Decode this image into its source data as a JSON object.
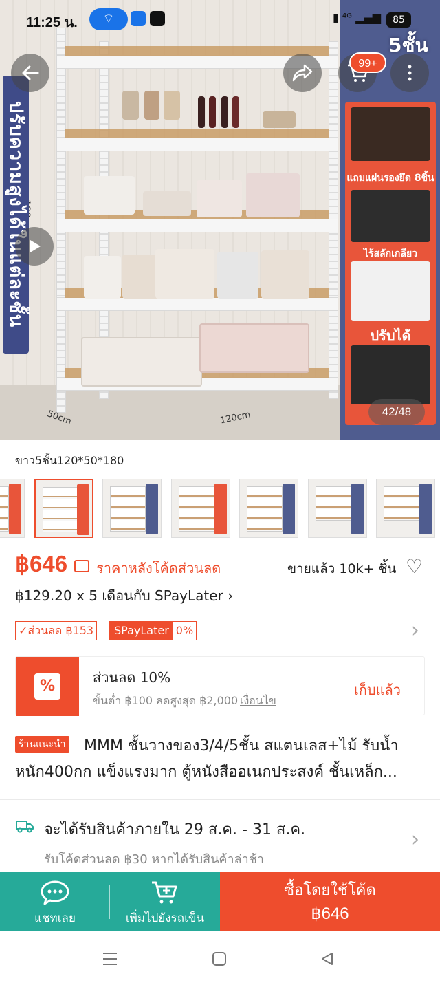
{
  "status_bar": {
    "time": "11:25 น.",
    "battery": "85"
  },
  "hero": {
    "left_banner": "ปรับความสูงได้ในแต่ละชั้น",
    "right_title": "5ชั้น",
    "feature_labels": [
      "แถมแผ่นรองยึด 8ชิ้น",
      "ไร้สลักเกลียว",
      "ปรับได้"
    ],
    "dim_height": "180cm",
    "dim_depth": "50cm",
    "dim_width": "120cm",
    "cart_badge": "99+",
    "image_counter": "42/48"
  },
  "variant": {
    "label": "ขาว5ชั้น120*50*180"
  },
  "price": {
    "value": "฿646",
    "note": "ราคาหลังโค้ดส่วนลด",
    "sold": "ขายแล้ว 10k+ ชิ้น",
    "installment": "฿129.20 x 5 เดือนกับ SPayLater"
  },
  "vouchers": {
    "discount": "✓ส่วนลด ฿153",
    "spaylater": "SPayLater",
    "spaylater_pct": "0%"
  },
  "coupon": {
    "title": "ส่วนลด 10%",
    "detail": "ขั้นต่ำ ฿100 ลดสูงสุด ฿2,000",
    "conditions": "เงื่อนไข",
    "action": "เก็บแล้ว"
  },
  "product": {
    "shop_tag": "ร้านแนะนำ",
    "title": "MMM ชั้นวางของ3/4/5ชั้น สแตนเลส+ไม้ รับน้ำหนัก400กก แข็งแรงมาก  ตู้หนังสืออเนกประสงค์ ชั้นเหล็ก..."
  },
  "shipping": {
    "line1": "จะได้รับสินค้าภายใน 29 ส.ค. - 31 ส.ค.",
    "line2": "รับโค้ดส่วนลด ฿30 หากได้รับสินค้าล่าช้า"
  },
  "bottom_bar": {
    "chat": "แชทเลย",
    "add_cart": "เพิ่มไปยังรถเข็น",
    "buy_line1": "ซื้อโดยใช้โค้ด",
    "buy_line2": "฿646"
  },
  "colors": {
    "accent": "#ee4d2d",
    "teal": "#26aa99"
  }
}
